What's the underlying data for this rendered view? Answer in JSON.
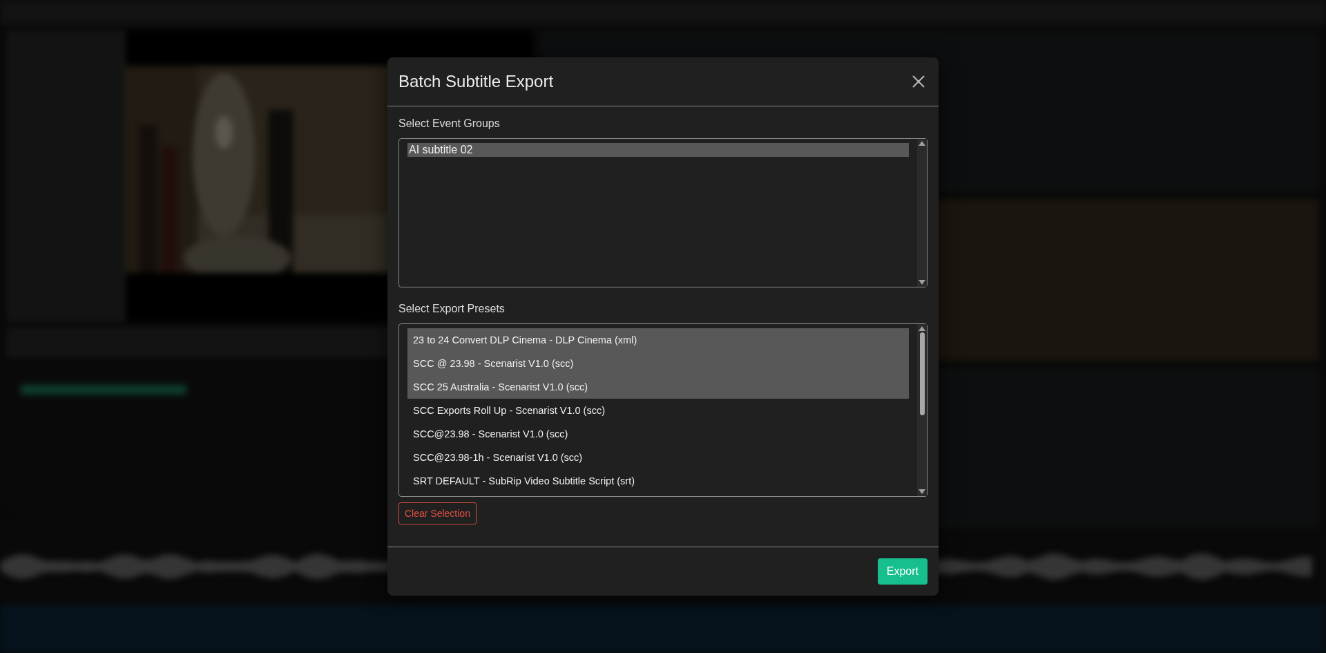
{
  "dialog": {
    "title": "Batch Subtitle Export",
    "event_groups": {
      "label": "Select Event Groups",
      "items": [
        {
          "label": "AI subtitle 02",
          "selected": true
        }
      ]
    },
    "export_presets": {
      "label": "Select Export Presets",
      "items": [
        {
          "label": "23 to 24 Convert DLP Cinema - DLP Cinema (xml)",
          "selected": true
        },
        {
          "label": "SCC @ 23.98 - Scenarist V1.0 (scc)",
          "selected": true
        },
        {
          "label": "SCC 25 Australia - Scenarist V1.0 (scc)",
          "selected": true
        },
        {
          "label": "SCC Exports Roll Up - Scenarist V1.0 (scc)",
          "selected": false
        },
        {
          "label": "SCC@23.98 - Scenarist V1.0 (scc)",
          "selected": false
        },
        {
          "label": "SCC@23.98-1h - Scenarist V1.0 (scc)",
          "selected": false
        },
        {
          "label": "SRT DEFAULT - SubRip Video Subtitle Script (srt)",
          "selected": false
        }
      ]
    },
    "clear_button": "Clear Selection",
    "export_button": "Export"
  }
}
